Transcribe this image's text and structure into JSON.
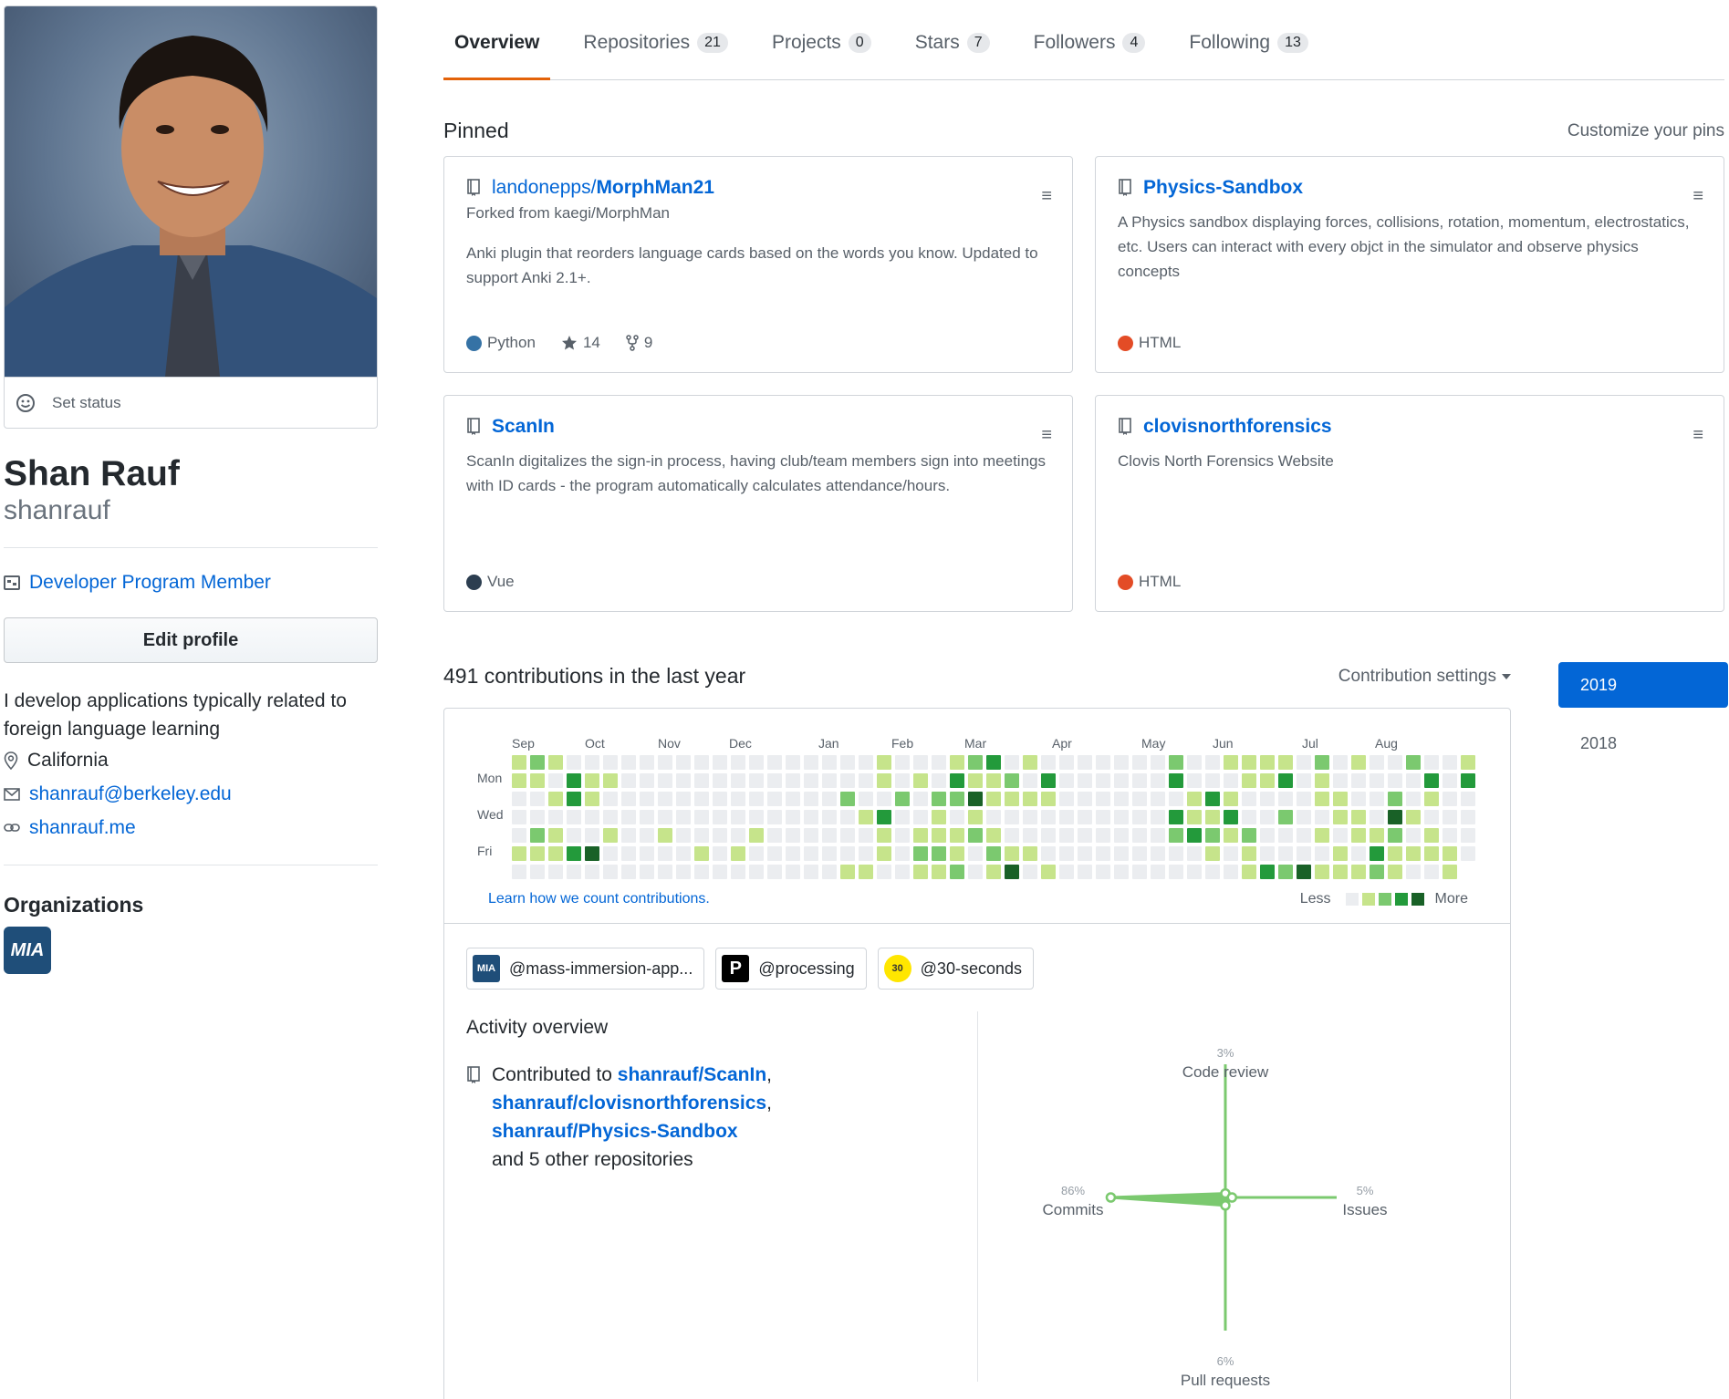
{
  "profile": {
    "set_status": "Set status",
    "full_name": "Shan Rauf",
    "username": "shanrauf",
    "badge": "Developer Program Member",
    "edit_profile": "Edit profile",
    "bio": "I develop applications typically related to foreign language learning",
    "location": "California",
    "email": "shanrauf@berkeley.edu",
    "website": "shanrauf.me",
    "organizations_title": "Organizations",
    "org_avatar_text": "MIA"
  },
  "tabs": [
    {
      "label": "Overview",
      "count": ""
    },
    {
      "label": "Repositories",
      "count": "21"
    },
    {
      "label": "Projects",
      "count": "0"
    },
    {
      "label": "Stars",
      "count": "7"
    },
    {
      "label": "Followers",
      "count": "4"
    },
    {
      "label": "Following",
      "count": "13"
    }
  ],
  "pinned": {
    "title": "Pinned",
    "customize": "Customize your pins",
    "items": [
      {
        "owner": "landonepps/",
        "name": "MorphMan21",
        "fork": "Forked from kaegi/MorphMan",
        "desc": "Anki plugin that reorders language cards based on the words you know. Updated to support Anki 2.1+.",
        "language": "Python",
        "lang_color": "#3572A5",
        "stars": "14",
        "forks": "9"
      },
      {
        "owner": "",
        "name": "Physics-Sandbox",
        "fork": "",
        "desc": "A Physics sandbox displaying forces, collisions, rotation, momentum, electrostatics, etc. Users can interact with every objct in the simulator and observe physics concepts",
        "language": "HTML",
        "lang_color": "#e34c26",
        "stars": "",
        "forks": ""
      },
      {
        "owner": "",
        "name": "ScanIn",
        "fork": "",
        "desc": "ScanIn digitalizes the sign-in process, having club/team members sign into meetings with ID cards - the program automatically calculates attendance/hours.",
        "language": "Vue",
        "lang_color": "#2c3e50",
        "stars": "",
        "forks": ""
      },
      {
        "owner": "",
        "name": "clovisnorthforensics",
        "fork": "",
        "desc": "Clovis North Forensics Website",
        "language": "HTML",
        "lang_color": "#e34c26",
        "stars": "",
        "forks": ""
      }
    ]
  },
  "contributions": {
    "title": "491 contributions in the last year",
    "settings": "Contribution settings",
    "months": [
      "Sep",
      "Oct",
      "Nov",
      "Dec",
      "Jan",
      "Feb",
      "Mar",
      "Apr",
      "May",
      "Jun",
      "Jul",
      "Aug"
    ],
    "days": [
      "Mon",
      "Wed",
      "Fri"
    ],
    "learn": "Learn how we count contributions.",
    "less": "Less",
    "more": "More",
    "colors": [
      "#ebedf0",
      "#c6e48b",
      "#7bc96f",
      "#239a3b",
      "#196127"
    ],
    "years": [
      "2019",
      "2018"
    ]
  },
  "org_filters": [
    {
      "label": "@mass-immersion-app...",
      "icon": "mia-org-icon",
      "bg": "#1f4e79"
    },
    {
      "label": "@processing",
      "icon": "processing-org-icon",
      "bg": "#000000"
    },
    {
      "label": "@30-seconds",
      "icon": "30-seconds-org-icon",
      "bg": "#ffe600"
    }
  ],
  "activity": {
    "title": "Activity overview",
    "prefix": "Contributed to ",
    "repos": [
      "shanrauf/ScanIn",
      "shanrauf/clovisnorthforensics",
      "shanrauf/Physics-Sandbox"
    ],
    "suffix": "and 5 other repositories",
    "radar": {
      "code_review": {
        "label": "Code review",
        "pct": "3%",
        "value": 3
      },
      "issues": {
        "label": "Issues",
        "pct": "5%",
        "value": 5
      },
      "pull_requests": {
        "label": "Pull requests",
        "pct": "6%",
        "value": 6
      },
      "commits": {
        "label": "Commits",
        "pct": "86%",
        "value": 86
      }
    }
  }
}
